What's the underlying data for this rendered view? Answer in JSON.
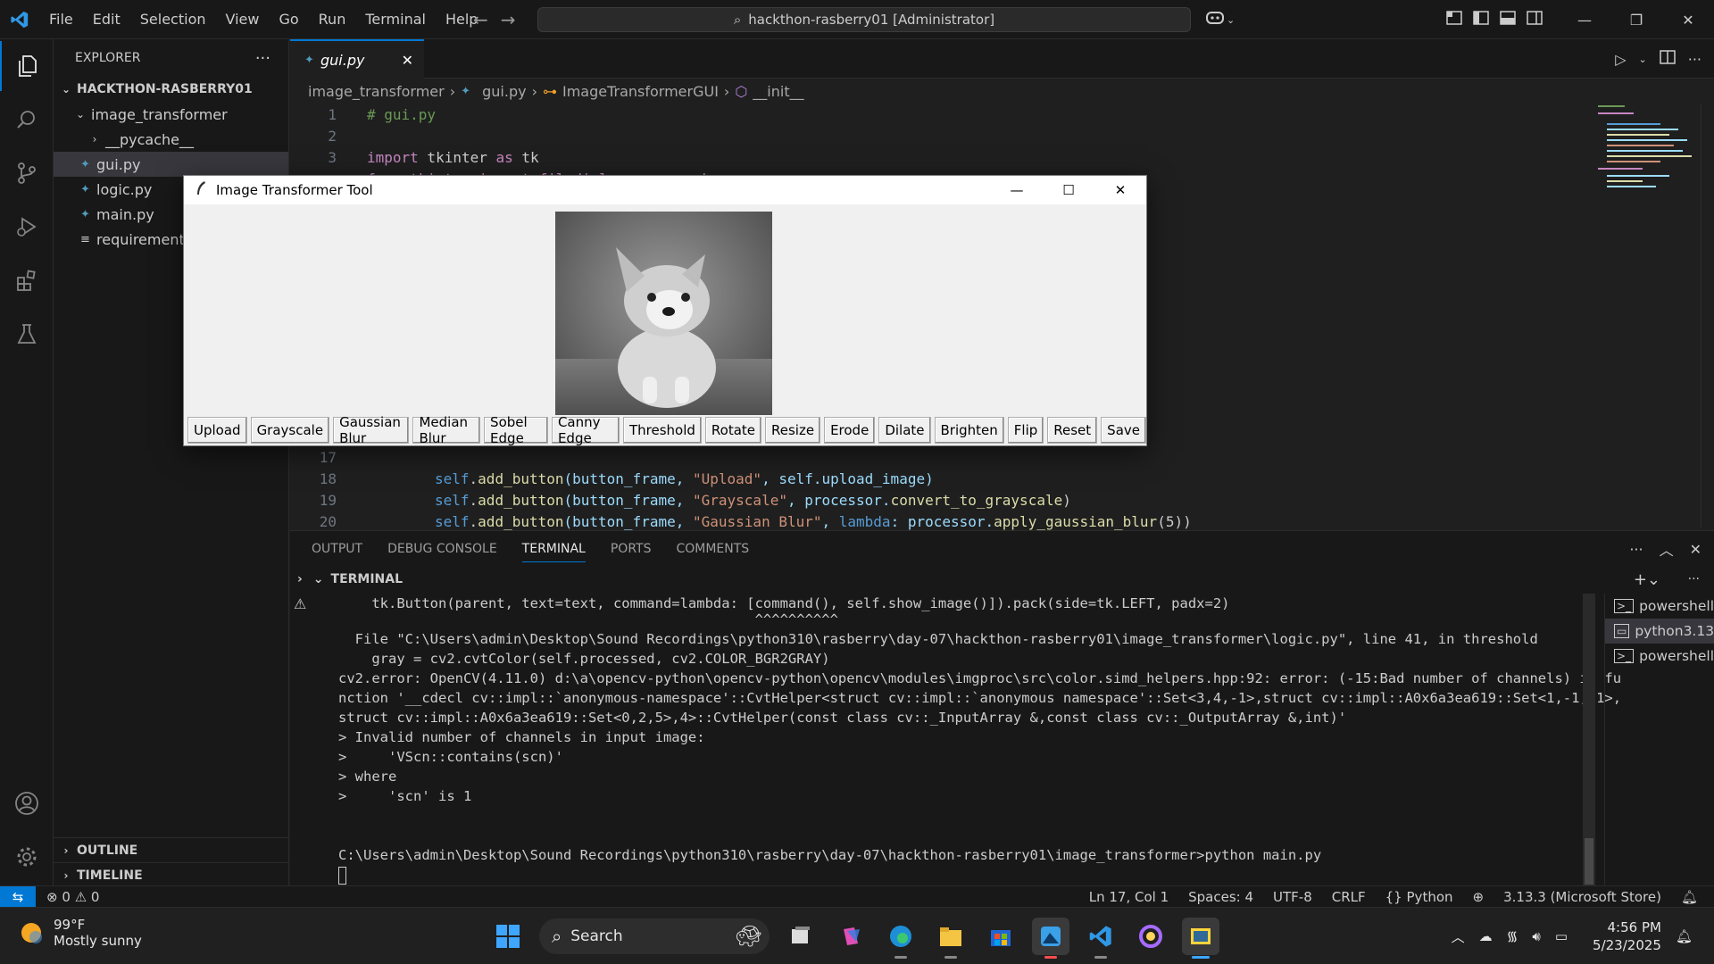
{
  "titlebar": {
    "menu": [
      "File",
      "Edit",
      "Selection",
      "View",
      "Go",
      "Run",
      "Terminal",
      "Help"
    ],
    "command_center": "hackthon-rasberry01 [Administrator]"
  },
  "explorer": {
    "title": "EXPLORER",
    "workspace": "HACKTHON-RASBERRY01",
    "folder": "image_transformer",
    "items": [
      "__pycache__",
      "gui.py",
      "logic.py",
      "main.py",
      "requirements"
    ],
    "outline": "OUTLINE",
    "timeline": "TIMELINE"
  },
  "editor": {
    "tab": "gui.py",
    "breadcrumb": [
      "image_transformer",
      "gui.py",
      "ImageTransformerGUI",
      "__init__"
    ],
    "lines": {
      "n1": "1",
      "n2": "2",
      "n3": "3",
      "n17": "17",
      "n18": "18",
      "n19": "19",
      "n20": "20",
      "l1": "# gui.py",
      "l3a": "import",
      "l3b": " tkinter ",
      "l3c": "as",
      "l3d": " tk",
      "l4": "from tkinter import filedialog, messagebox",
      "l18a": "self",
      "l18b": ".",
      "l18c": "add_button",
      "l18d": "(button_frame, ",
      "l18e": "\"Upload\"",
      "l18f": ", self.upload_image)",
      "l19c": "add_button",
      "l19d": "(button_frame, ",
      "l19e": "\"Grayscale\"",
      "l19f": ", processor.",
      "l19g": "convert_to_grayscale",
      "l19h": ")",
      "l20c": "add_button",
      "l20d": "(button_frame, ",
      "l20e": "\"Gaussian Blur\"",
      "l20f": ", ",
      "l20g": "lambda",
      "l20h": ": processor.",
      "l20i": "apply_gaussian_blur",
      "l20j": "(5))"
    }
  },
  "panel": {
    "tabs": [
      "OUTPUT",
      "DEBUG CONSOLE",
      "TERMINAL",
      "PORTS",
      "COMMENTS"
    ],
    "active_tab": "TERMINAL",
    "terminal_title": "TERMINAL",
    "terminal_lines": [
      "    tk.Button(parent, text=text, command=lambda: [command(), self.show_image()]).pack(side=tk.LEFT, padx=2)",
      "                                                  ^^^^^^^^^^",
      "  File \"C:\\Users\\admin\\Desktop\\Sound Recordings\\python310\\rasberry\\day-07\\hackthon-rasberry01\\image_transformer\\logic.py\", line 41, in threshold",
      "    gray = cv2.cvtColor(self.processed, cv2.COLOR_BGR2GRAY)",
      "cv2.error: OpenCV(4.11.0) d:\\a\\opencv-python\\opencv-python\\opencv\\modules\\imgproc\\src\\color.simd_helpers.hpp:92: error: (-15:Bad number of channels) in fu",
      "nction '__cdecl cv::impl::`anonymous-namespace'::CvtHelper<struct cv::impl::`anonymous namespace'::Set<3,4,-1>,struct cv::impl::A0x6a3ea619::Set<1,-1,-1>,",
      "struct cv::impl::A0x6a3ea619::Set<0,2,5>,4>::CvtHelper(const class cv::_InputArray &,const class cv::_OutputArray &,int)'",
      "> Invalid number of channels in input image:",
      ">     'VScn::contains(scn)'",
      "> where",
      ">     'scn' is 1",
      "",
      "",
      "C:\\Users\\admin\\Desktop\\Sound Recordings\\python310\\rasberry\\day-07\\hackthon-rasberry01\\image_transformer>python main.py"
    ],
    "terminals": [
      "powershell",
      "python3.13",
      "powershell"
    ]
  },
  "statusbar": {
    "errors": "0",
    "warnings": "0",
    "position": "Ln 17, Col 1",
    "spaces": "Spaces: 4",
    "encoding": "UTF-8",
    "eol": "CRLF",
    "language": "Python",
    "interpreter": "3.13.3 (Microsoft Store)"
  },
  "taskbar": {
    "temp": "99°F",
    "weather": "Mostly sunny",
    "search": "Search",
    "time": "4:56 PM",
    "date": "5/23/2025"
  },
  "tk_window": {
    "title": "Image Transformer Tool",
    "buttons": [
      "Upload",
      "Grayscale",
      "Gaussian Blur",
      "Median Blur",
      "Sobel Edge",
      "Canny Edge",
      "Threshold",
      "Rotate",
      "Resize",
      "Erode",
      "Dilate",
      "Brighten",
      "Flip",
      "Reset",
      "Save"
    ]
  },
  "colors": {
    "accent": "#0078d4",
    "editor_bg": "#1f1f1f",
    "sidebar_bg": "#181818",
    "tk_bg": "#f0f0f0"
  }
}
